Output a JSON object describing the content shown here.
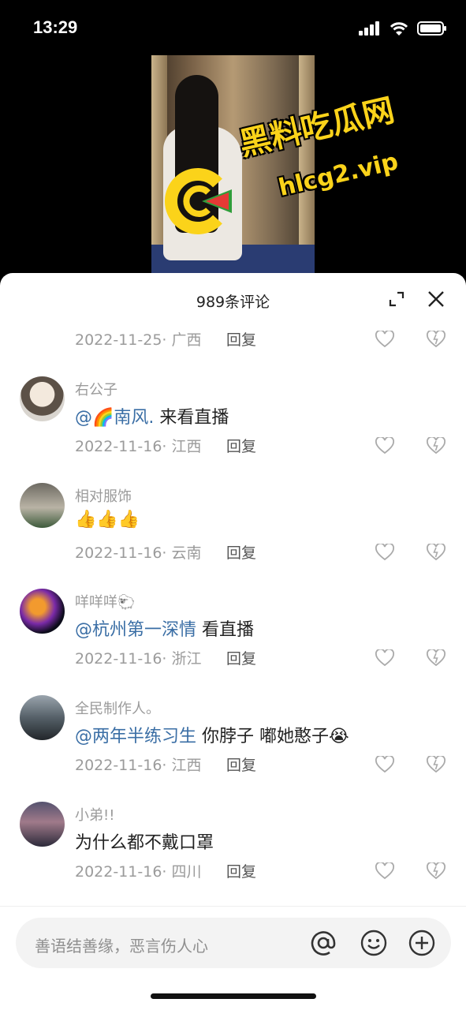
{
  "status": {
    "time": "13:29"
  },
  "watermark": {
    "title": "黑料吃瓜网",
    "url": "hlcg2.vip"
  },
  "sheet": {
    "title": "989条评论"
  },
  "top_meta": {
    "date_location": "2022-11-25· 广西",
    "reply": "回复"
  },
  "comments": [
    {
      "username": "右公子",
      "mention": "@🌈南风.",
      "text": " 来看直播",
      "date_location": "2022-11-16· 江西",
      "reply": "回复"
    },
    {
      "username": "相对服饰",
      "mention": "",
      "text": "👍👍👍",
      "date_location": "2022-11-16· 云南",
      "reply": "回复"
    },
    {
      "username": "咩咩咩🐑",
      "mention": "@杭州第一深情",
      "text": " 看直播",
      "date_location": "2022-11-16· 浙江",
      "reply": "回复"
    },
    {
      "username": "全民制作人。",
      "mention": "@两年半练习生",
      "text": " 你脖子 嘟她憨子😭",
      "date_location": "2022-11-16· 江西",
      "reply": "回复"
    },
    {
      "username": "小弟!!",
      "mention": "",
      "text": "为什么都不戴口罩",
      "date_location": "2022-11-16· 四川",
      "reply": "回复"
    }
  ],
  "input": {
    "placeholder": "善语结善缘，恶言伤人心"
  },
  "colors": {
    "watermark": "#fbd31a",
    "mention": "#3a6ea5",
    "meta": "#9b9b9b"
  }
}
